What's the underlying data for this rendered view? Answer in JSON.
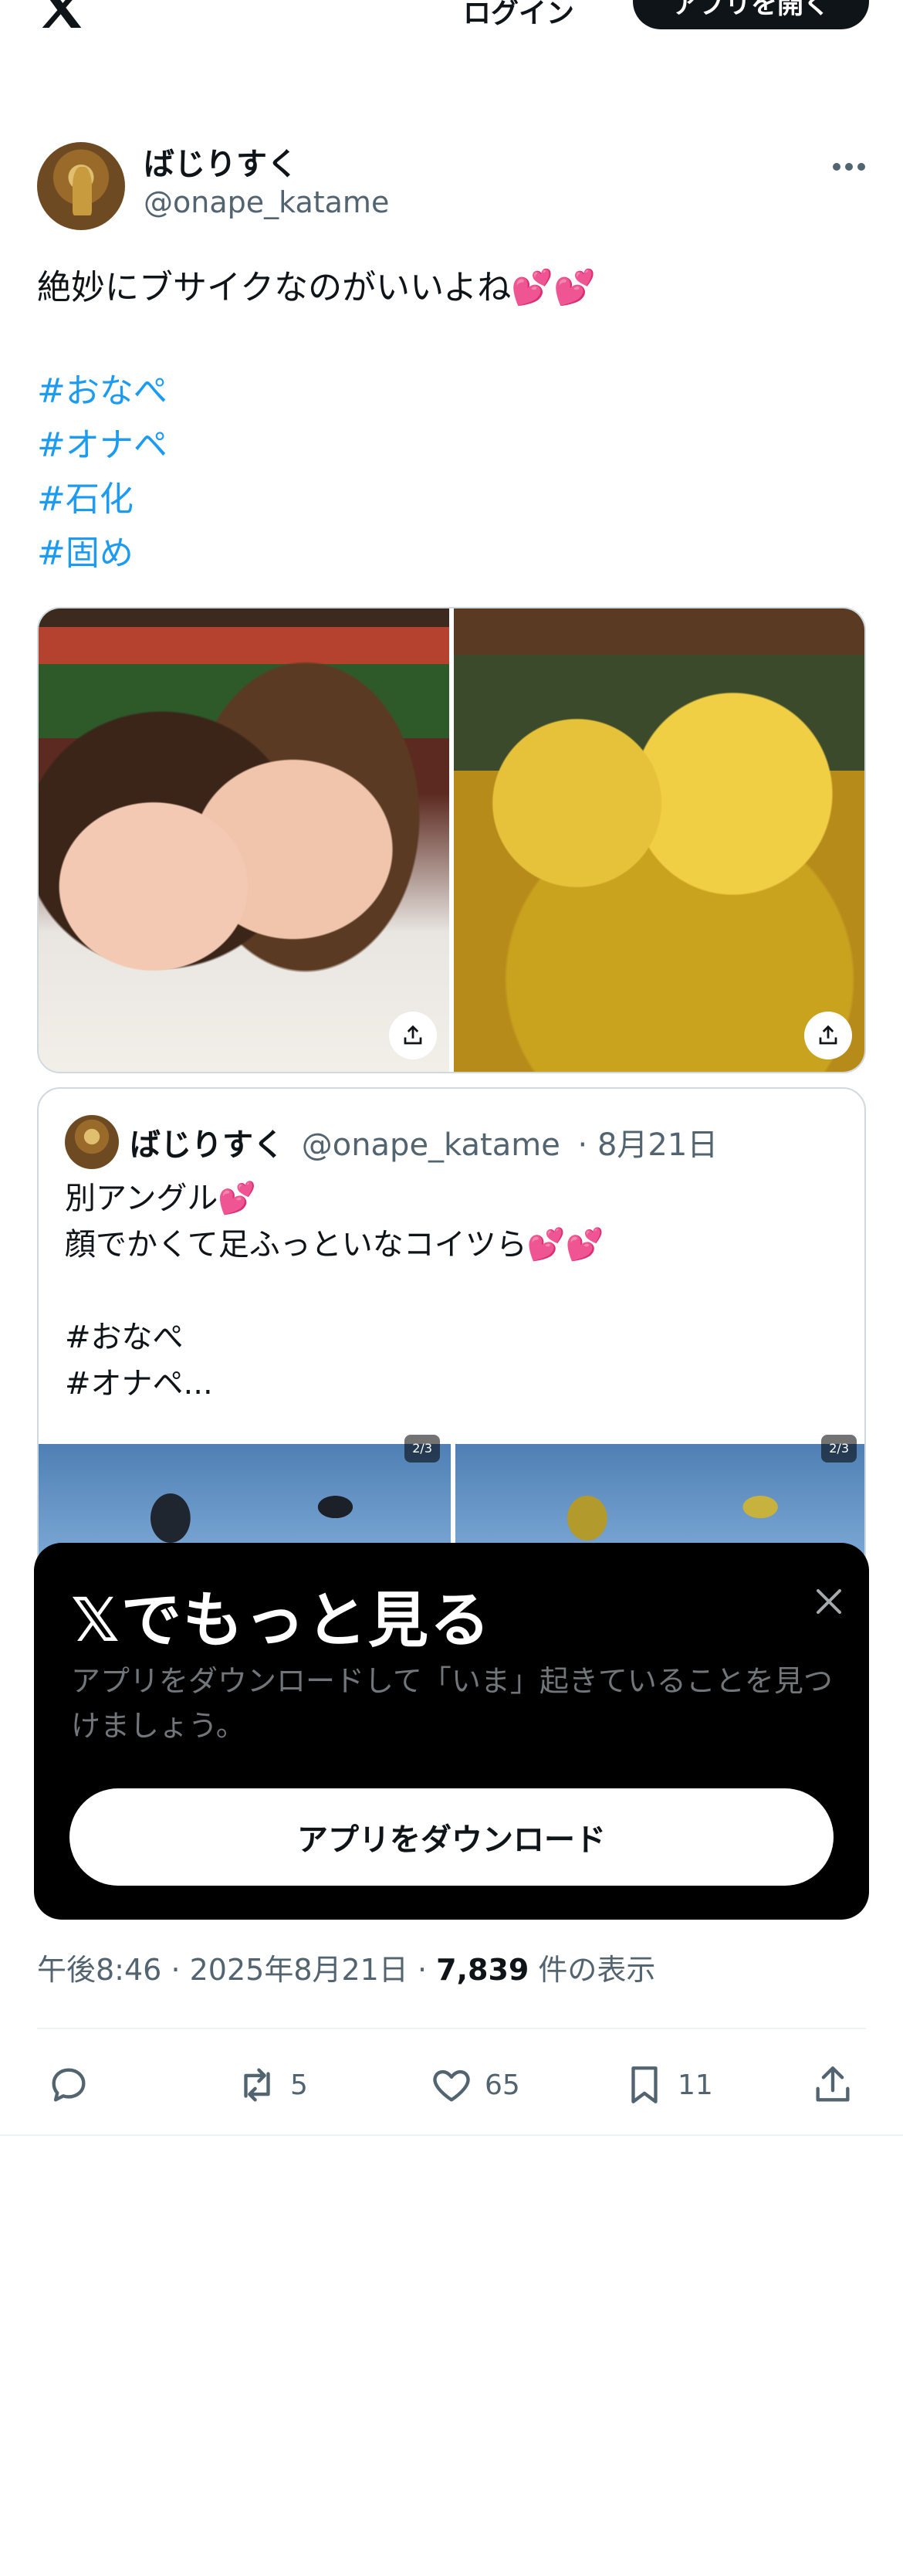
{
  "topbar": {
    "login_label": "ログイン",
    "open_app_label": "アプリを開く"
  },
  "author": {
    "name": "ばじりすく",
    "handle": "@onape_katame"
  },
  "tweet": {
    "text": "絶妙にブサイクなのがいいよね💕💕",
    "hashtags": [
      "#おなぺ",
      "#オナペ",
      "#石化",
      "#固め"
    ]
  },
  "quote": {
    "name": "ばじりすく",
    "handle": "@onape_katame",
    "date": "· 8月21日",
    "text": "別アングル💕\n顔でかくて足ふっといなコイツら💕💕\n\n#おなぺ\n#オナペ...",
    "media_counts": [
      "2/3",
      "2/3"
    ]
  },
  "promo": {
    "title": "𝕏でもっと見る",
    "subtitle": "アプリをダウンロードして「いま」起きていることを見つけましょう。",
    "button_label": "アプリをダウンロード"
  },
  "meta": {
    "time": "午後8:46",
    "date": "2025年8月21日",
    "views": "7,839",
    "views_label": "件の表示"
  },
  "actions": {
    "retweets": "5",
    "likes": "65",
    "bookmarks": "11"
  },
  "colors": {
    "link": "#1d9bf0",
    "text": "#0f1419",
    "secondary": "#536471",
    "heart": "#e8365d"
  },
  "icons": [
    "x-logo-icon",
    "more-icon",
    "share-icon",
    "close-icon",
    "reply-icon",
    "retweet-icon",
    "heart-icon",
    "bookmark-icon"
  ]
}
